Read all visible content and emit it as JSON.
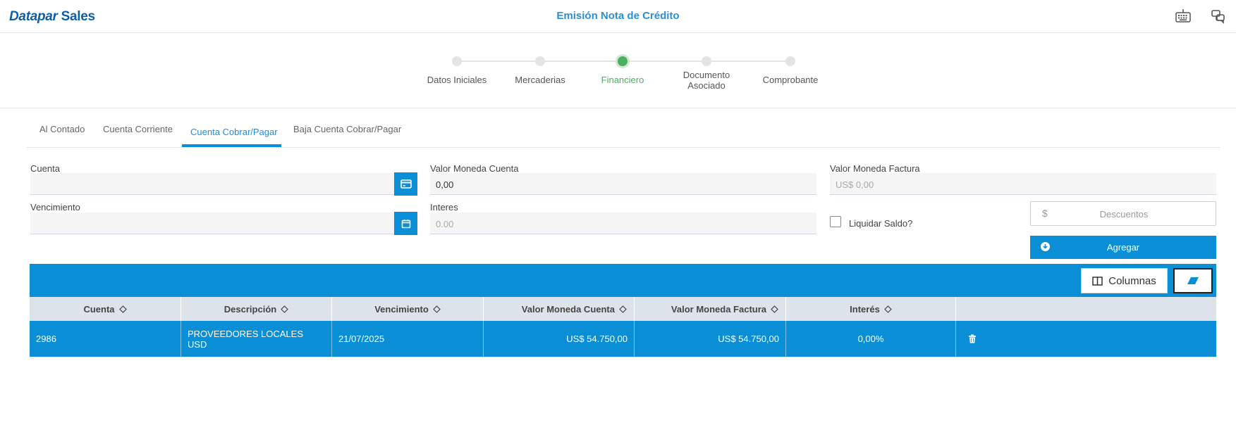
{
  "header": {
    "brand_first": "Datapar",
    "brand_second": "Sales",
    "title": "Emisión Nota de Crédito",
    "icons": [
      "keyboard-icon",
      "chat-icon"
    ]
  },
  "stepper": {
    "steps": [
      {
        "label": "Datos Iniciales"
      },
      {
        "label": "Mercaderias"
      },
      {
        "label": "Financiero",
        "active": true
      },
      {
        "label_line1": "Documento",
        "label_line2": "Asociado"
      },
      {
        "label": "Comprobante"
      }
    ]
  },
  "tabs": [
    {
      "label": "Al Contado"
    },
    {
      "label": "Cuenta Corriente"
    },
    {
      "label": "Cuenta Cobrar/Pagar",
      "active": true
    },
    {
      "label": "Baja Cuenta Cobrar/Pagar"
    }
  ],
  "form": {
    "cuenta_label": "Cuenta",
    "cuenta_value": "",
    "vencimiento_label": "Vencimiento",
    "vencimiento_value": "",
    "valor_moneda_cuenta_label": "Valor Moneda Cuenta",
    "valor_moneda_cuenta_value": "0,00",
    "interes_label": "Interes",
    "interes_value": "0.00",
    "valor_moneda_factura_label": "Valor Moneda Factura",
    "valor_moneda_factura_value": "US$ 0,00",
    "liquidar_saldo_label": "Liquidar Saldo?",
    "descuentos_symbol": "$",
    "descuentos_placeholder": "Descuentos",
    "agregar_label": "Agregar"
  },
  "table": {
    "columnas_label": "Columnas",
    "columns": [
      "Cuenta",
      "Descripción",
      "Vencimiento",
      "Valor Moneda Cuenta",
      "Valor Moneda Factura",
      "Interés"
    ],
    "rows": [
      {
        "cuenta": "2986",
        "descripcion": "PROVEEDORES LOCALES USD",
        "vencimiento": "21/07/2025",
        "valor_moneda_cuenta": "US$ 54.750,00",
        "valor_moneda_factura": "US$ 54.750,00",
        "interes": "0,00%"
      }
    ]
  },
  "colors": {
    "primary": "#0a8fd6",
    "active_step": "#4caf60",
    "brand": "#0e5fa6"
  }
}
